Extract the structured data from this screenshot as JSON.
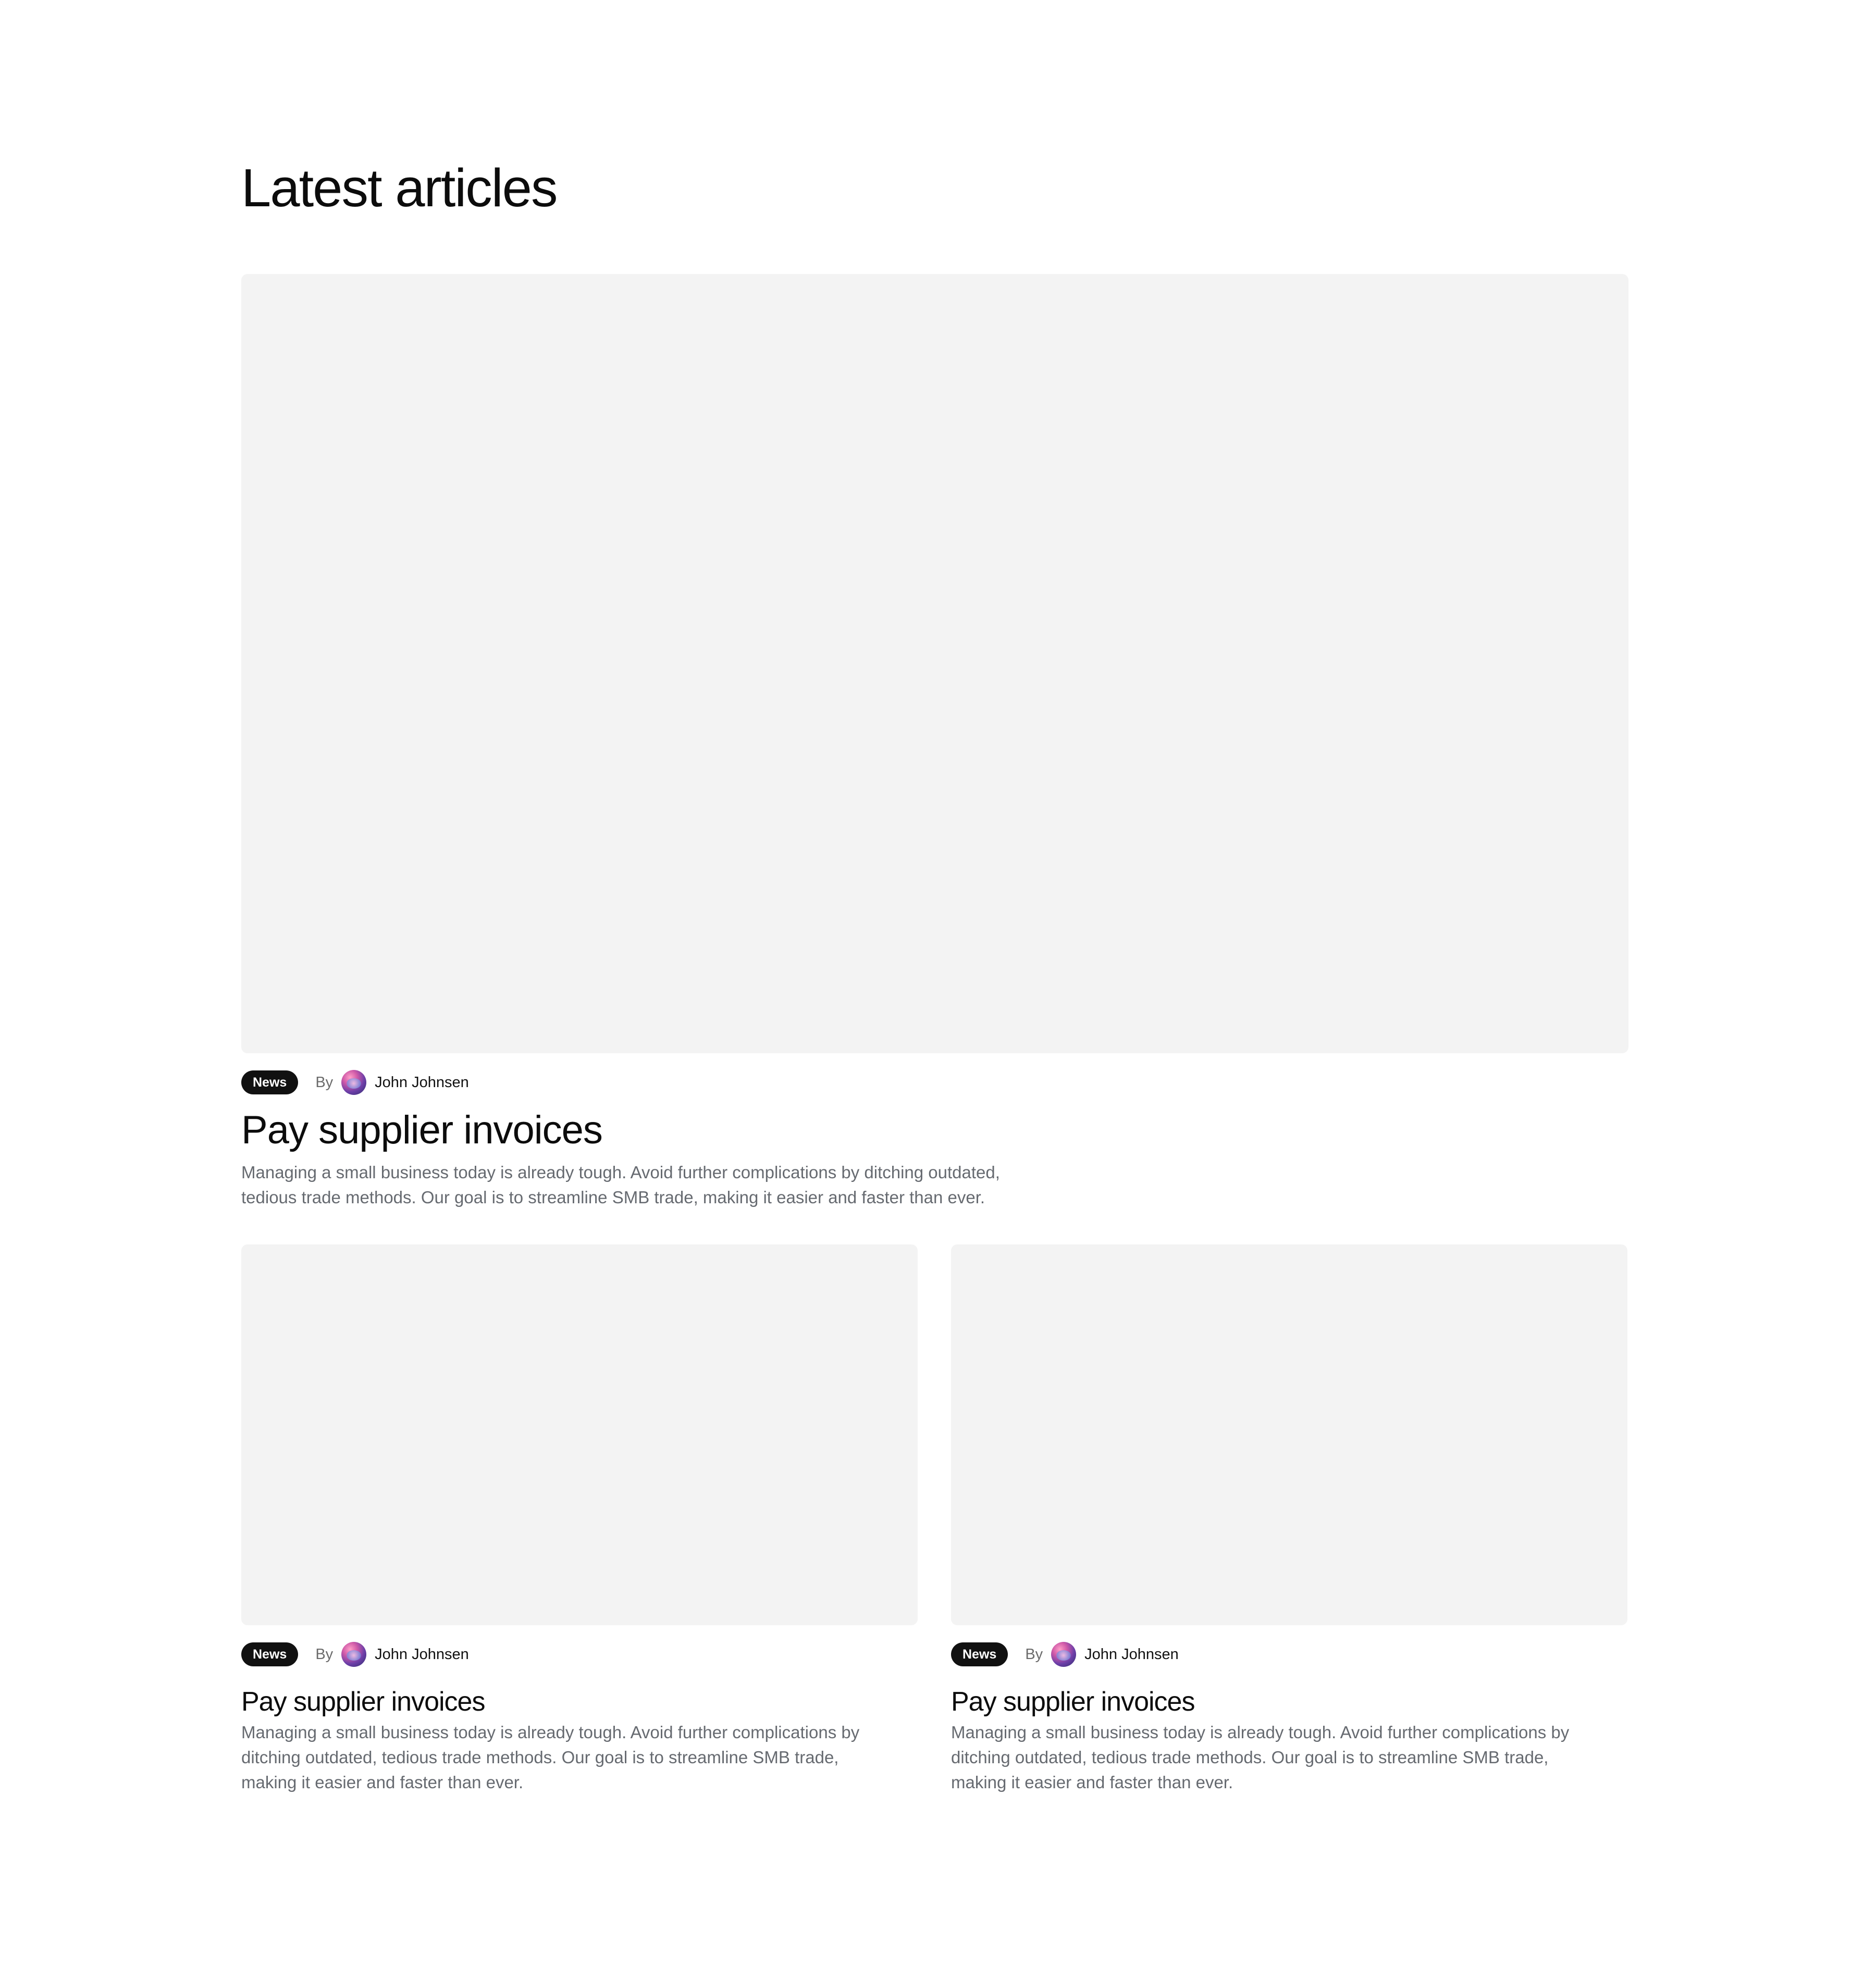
{
  "section": {
    "title": "Latest articles"
  },
  "featured": {
    "tag": "News",
    "by": "By",
    "author": "John Johnsen",
    "title": "Pay supplier invoices",
    "description": "Managing a small business today is already tough. Avoid further complications by ditching outdated, tedious trade methods. Our goal is to streamline SMB trade, making it easier and faster than ever."
  },
  "articles": [
    {
      "tag": "News",
      "by": "By",
      "author": "John Johnsen",
      "title": "Pay supplier invoices",
      "description": "Managing a small business today is already tough. Avoid further complications by ditching outdated, tedious trade methods. Our goal is to streamline SMB trade, making it easier and faster than ever."
    },
    {
      "tag": "News",
      "by": "By",
      "author": "John Johnsen",
      "title": "Pay supplier invoices",
      "description": "Managing a small business today is already tough. Avoid further complications by ditching outdated, tedious trade methods. Our goal is to streamline SMB trade, making it easier and faster than ever."
    }
  ],
  "colors": {
    "image_placeholder": "#f3f3f3",
    "badge_bg": "#111111",
    "body_text": "#666a70"
  }
}
